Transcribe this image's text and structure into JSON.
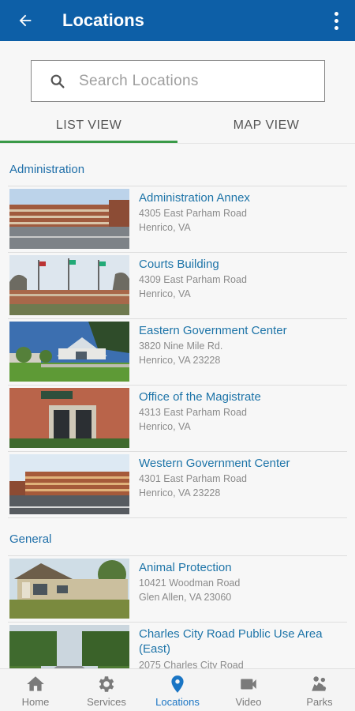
{
  "appbar": {
    "title": "Locations",
    "back_icon": "arrow-left-icon",
    "menu_icon": "more-vert-icon"
  },
  "search": {
    "placeholder": "Search Locations",
    "icon": "search-icon"
  },
  "tabs": [
    {
      "label": "LIST VIEW",
      "selected": true
    },
    {
      "label": "MAP VIEW",
      "selected": false
    }
  ],
  "sections": [
    {
      "title": "Administration",
      "items": [
        {
          "name": "Administration Annex",
          "line1": "4305 East Parham Road",
          "line2": "Henrico, VA"
        },
        {
          "name": "Courts Building",
          "line1": "4309 East Parham Road",
          "line2": "Henrico, VA"
        },
        {
          "name": "Eastern Government Center",
          "line1": "3820 Nine Mile Rd.",
          "line2": "Henrico, VA 23228"
        },
        {
          "name": "Office of the Magistrate",
          "line1": "4313 East Parham Road",
          "line2": "Henrico, VA"
        },
        {
          "name": "Western Government Center",
          "line1": "4301 East Parham Road",
          "line2": "Henrico, VA 23228"
        }
      ]
    },
    {
      "title": "General",
      "items": [
        {
          "name": "Animal Protection",
          "line1": "10421 Woodman Road",
          "line2": "Glen Allen, VA 23060"
        },
        {
          "name": "Charles City Road Public Use Area",
          "name2": "(East)",
          "line1": "2075 Charles City Road"
        }
      ]
    }
  ],
  "bottom_nav": [
    {
      "label": "Home",
      "icon": "home-icon",
      "active": false
    },
    {
      "label": "Services",
      "icon": "gear-icon",
      "active": false
    },
    {
      "label": "Locations",
      "icon": "location-pin-icon",
      "active": true
    },
    {
      "label": "Video",
      "icon": "video-camera-icon",
      "active": false
    },
    {
      "label": "Parks",
      "icon": "parks-icon",
      "active": false
    }
  ],
  "colors": {
    "appbar": "#0d5fa7",
    "accent_tab": "#3a9a48",
    "link": "#1d74a8",
    "nav_active": "#1a75c4"
  }
}
